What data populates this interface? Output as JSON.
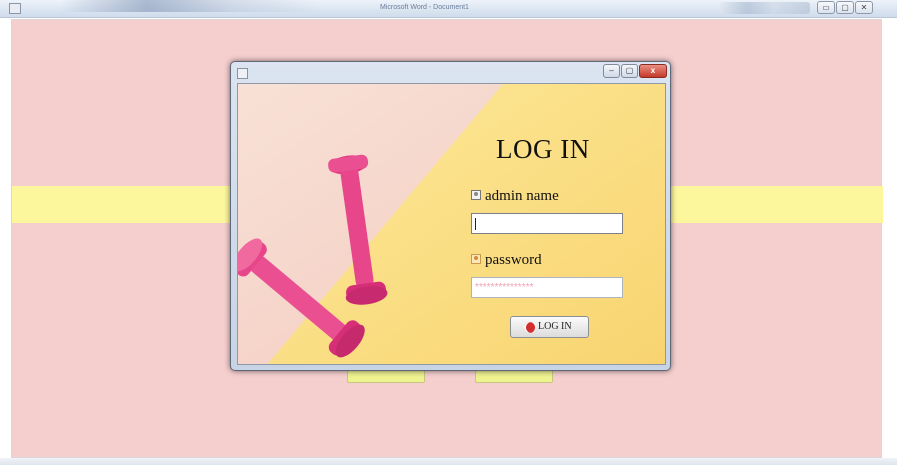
{
  "outer_window": {
    "title": "Microsoft Word - Document1",
    "controls": {
      "minimize": "▭",
      "maximize": "▢",
      "close": "✕"
    }
  },
  "background": {
    "panel_color": "#f5cece",
    "stripe_color": "#fcf69c"
  },
  "dialog": {
    "controls": {
      "minimize": "–",
      "maximize": "▢",
      "close": "x"
    },
    "title": "LOG IN",
    "admin_label": "admin name",
    "admin_value": "",
    "password_label": "password",
    "password_value": "***************",
    "button_label": "LOG IN",
    "icons": [
      "user-icon",
      "key-icon",
      "login-power-icon",
      "dumbbell-illustration"
    ]
  }
}
